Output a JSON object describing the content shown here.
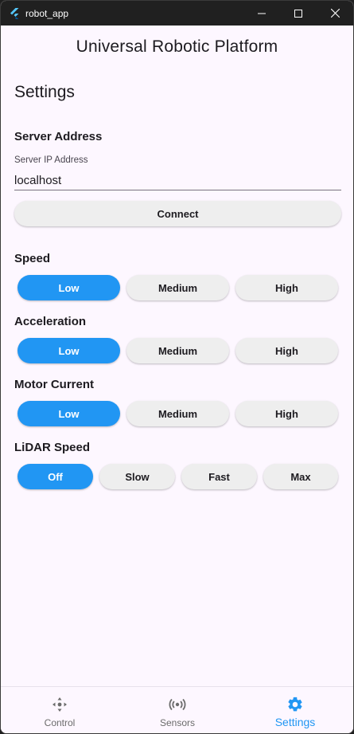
{
  "window": {
    "title": "robot_app"
  },
  "app": {
    "title": "Universal Robotic Platform"
  },
  "page": {
    "title": "Settings"
  },
  "server": {
    "section_label": "Server Address",
    "field_label": "Server IP Address",
    "field_value": "localhost",
    "connect_label": "Connect"
  },
  "speed": {
    "label": "Speed",
    "options": [
      "Low",
      "Medium",
      "High"
    ],
    "selected": "Low"
  },
  "acceleration": {
    "label": "Acceleration",
    "options": [
      "Low",
      "Medium",
      "High"
    ],
    "selected": "Low"
  },
  "motor_current": {
    "label": "Motor Current",
    "options": [
      "Low",
      "Medium",
      "High"
    ],
    "selected": "Low"
  },
  "lidar_speed": {
    "label": "LiDAR Speed",
    "options": [
      "Off",
      "Slow",
      "Fast",
      "Max"
    ],
    "selected": "Off"
  },
  "nav": {
    "items": [
      {
        "label": "Control",
        "icon": "gamepad-icon"
      },
      {
        "label": "Sensors",
        "icon": "sensors-icon"
      },
      {
        "label": "Settings",
        "icon": "gear-icon"
      }
    ],
    "active": "Settings"
  },
  "colors": {
    "accent": "#2196f3",
    "background": "#fdf7ff",
    "button": "#eeeeee",
    "titlebar": "#202020"
  }
}
